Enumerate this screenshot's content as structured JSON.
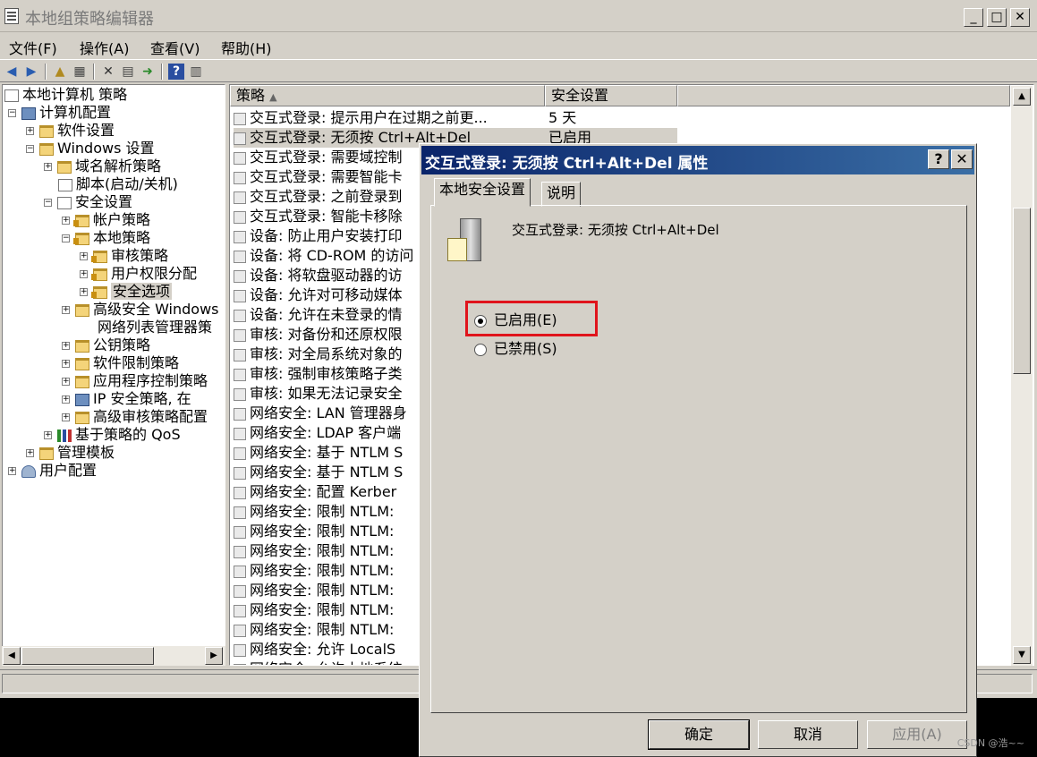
{
  "window": {
    "title": "本地组策略编辑器",
    "controls": {
      "minimize": "_",
      "maximize": "□",
      "close": "✕"
    }
  },
  "menu": [
    "文件(F)",
    "操作(A)",
    "查看(V)",
    "帮助(H)"
  ],
  "toolbar": {
    "icons": [
      "back-icon",
      "forward-icon",
      "up-folder-icon",
      "show-hide-tree-icon",
      "delete-icon",
      "properties-icon",
      "export-list-icon",
      "help-icon",
      "console-view-icon"
    ]
  },
  "tree": {
    "root": "本地计算机 策略",
    "computer_config": "计算机配置",
    "software_settings": "软件设置",
    "windows_settings": "Windows 设置",
    "dns_policy": "域名解析策略",
    "scripts": "脚本(启动/关机)",
    "security_settings": "安全设置",
    "account_policy": "帐户策略",
    "local_policy": "本地策略",
    "audit_policy": "审核策略",
    "user_rights": "用户权限分配",
    "security_options": "安全选项",
    "advanced_firewall": "高级安全 Windows",
    "network_list": "网络列表管理器策",
    "public_key": "公钥策略",
    "software_restriction": "软件限制策略",
    "app_control": "应用程序控制策略",
    "ip_security": "IP 安全策略, 在",
    "advanced_audit": "高级审核策略配置",
    "qos": "基于策略的 QoS",
    "admin_templates": "管理模板",
    "user_config": "用户配置"
  },
  "list": {
    "columns": [
      "策略",
      "安全设置"
    ],
    "rows": [
      {
        "policy": "交互式登录: 提示用户在过期之前更...",
        "setting": "5 天"
      },
      {
        "policy": "交互式登录: 无须按 Ctrl+Alt+Del",
        "setting": "已启用"
      },
      {
        "policy": "交互式登录: 需要域控制",
        "setting": ""
      },
      {
        "policy": "交互式登录: 需要智能卡",
        "setting": ""
      },
      {
        "policy": "交互式登录: 之前登录到",
        "setting": ""
      },
      {
        "policy": "交互式登录: 智能卡移除",
        "setting": ""
      },
      {
        "policy": "设备: 防止用户安装打印",
        "setting": ""
      },
      {
        "policy": "设备: 将 CD-ROM 的访问",
        "setting": ""
      },
      {
        "policy": "设备: 将软盘驱动器的访",
        "setting": ""
      },
      {
        "policy": "设备: 允许对可移动媒体",
        "setting": ""
      },
      {
        "policy": "设备: 允许在未登录的情",
        "setting": ""
      },
      {
        "policy": "审核: 对备份和还原权限",
        "setting": ""
      },
      {
        "policy": "审核: 对全局系统对象的",
        "setting": ""
      },
      {
        "policy": "审核: 强制审核策略子类",
        "setting": ""
      },
      {
        "policy": "审核: 如果无法记录安全",
        "setting": ""
      },
      {
        "policy": "网络安全: LAN 管理器身",
        "setting": ""
      },
      {
        "policy": "网络安全: LDAP 客户端",
        "setting": ""
      },
      {
        "policy": "网络安全: 基于 NTLM S",
        "setting": ""
      },
      {
        "policy": "网络安全: 基于 NTLM S",
        "setting": ""
      },
      {
        "policy": "网络安全: 配置 Kerber",
        "setting": ""
      },
      {
        "policy": "网络安全: 限制 NTLM:",
        "setting": ""
      },
      {
        "policy": "网络安全: 限制 NTLM:",
        "setting": ""
      },
      {
        "policy": "网络安全: 限制 NTLM:",
        "setting": ""
      },
      {
        "policy": "网络安全: 限制 NTLM:",
        "setting": ""
      },
      {
        "policy": "网络安全: 限制 NTLM:",
        "setting": ""
      },
      {
        "policy": "网络安全: 限制 NTLM:",
        "setting": ""
      },
      {
        "policy": "网络安全: 限制 NTLM:",
        "setting": ""
      },
      {
        "policy": "网络安全: 允许 LocalS",
        "setting": ""
      },
      {
        "policy": "网络安全: 允许本地系统",
        "setting": ""
      }
    ]
  },
  "dialog": {
    "title": "交互式登录: 无须按 Ctrl+Alt+Del 属性",
    "help": "?",
    "close": "✕",
    "tabs": [
      "本地安全设置",
      "说明"
    ],
    "policy_name": "交互式登录: 无须按 Ctrl+Alt+Del",
    "options": [
      {
        "label": "已启用(E)",
        "selected": true
      },
      {
        "label": "已禁用(S)",
        "selected": false
      }
    ],
    "buttons": {
      "ok": "确定",
      "cancel": "取消",
      "apply": "应用(A)"
    }
  },
  "watermark": "CSDN @浩~~",
  "colors": {
    "highlight_box": "#e0141c",
    "title_gradient_start": "#0a246a",
    "title_gradient_end": "#3a6ea5"
  }
}
